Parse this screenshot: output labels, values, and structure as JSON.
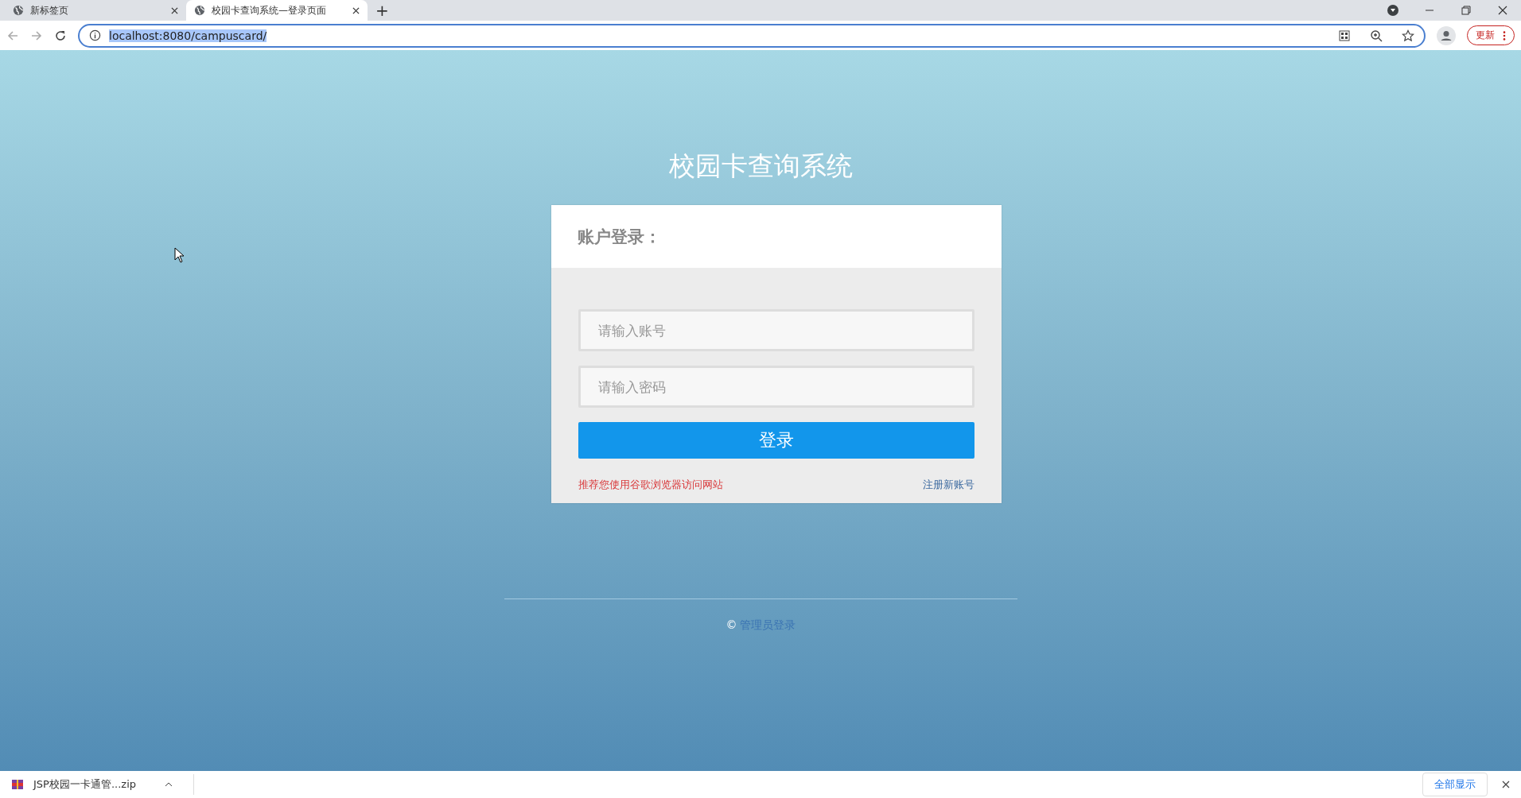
{
  "browser": {
    "tabs": [
      {
        "title": "新标签页",
        "selected": false
      },
      {
        "title": "校园卡查询系统—登录页面",
        "selected": true
      }
    ],
    "new_tab": "+",
    "address": "localhost:8080/campuscard/",
    "update_button": "更新"
  },
  "page": {
    "title": "校园卡查询系统",
    "card_title": "账户登录：",
    "fields": [
      {
        "placeholder": "请输入账号"
      },
      {
        "placeholder": "请输入密码"
      }
    ],
    "login_button": "登录",
    "hint": "推荐您使用谷歌浏览器访问网站",
    "register_link": "注册新账号",
    "footer_symbol": "©",
    "admin_link": "管理员登录"
  },
  "download_bar": {
    "file": "JSP校园一卡通管...zip",
    "show_all": "全部显示"
  }
}
